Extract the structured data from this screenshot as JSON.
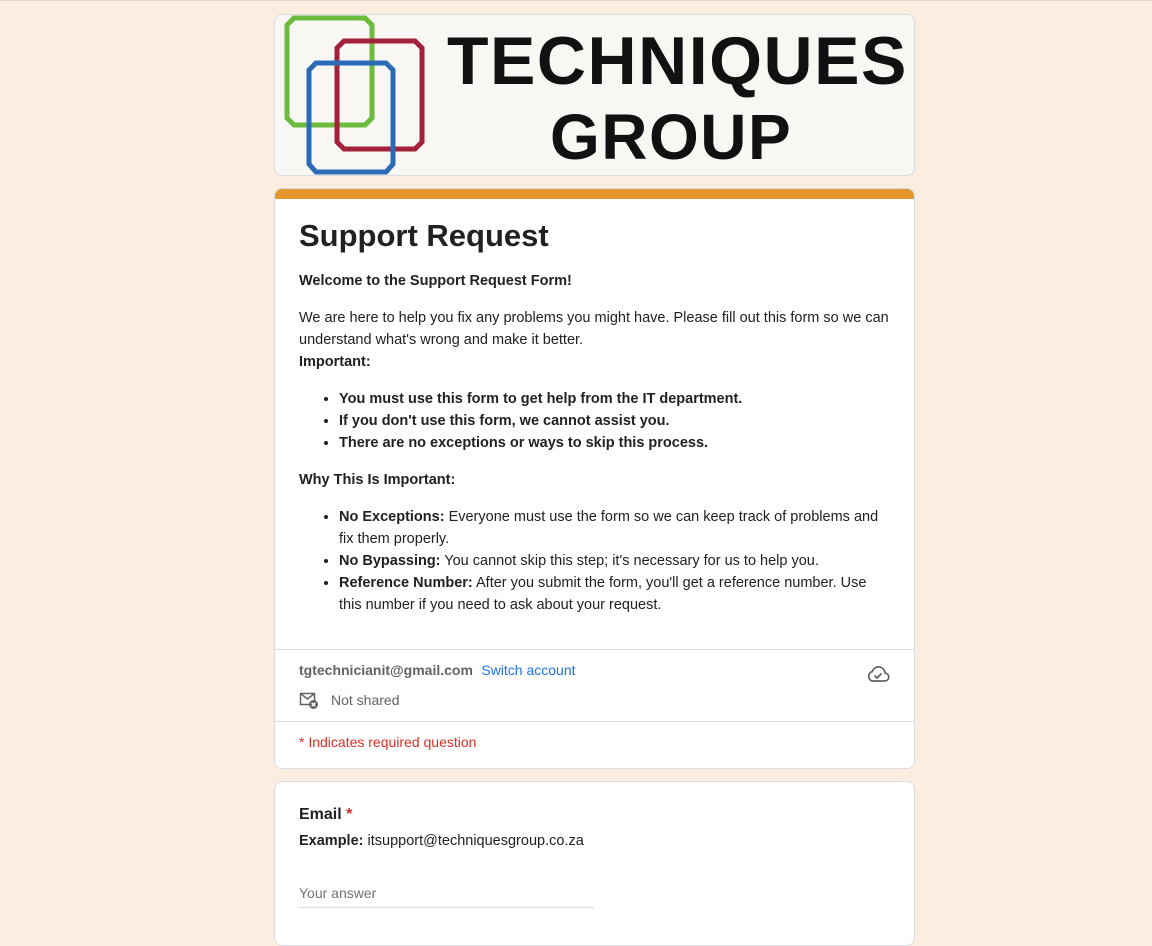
{
  "banner": {
    "brand_line_1": "TECHNIQUES",
    "brand_line_2": "GROUP",
    "logo_colors": {
      "green": "#6cbb3c",
      "red": "#a3213a",
      "blue": "#2b6cb8"
    }
  },
  "form": {
    "accent_color": "#e3972d",
    "title": "Support Request",
    "welcome": "Welcome to the Support Request Form!",
    "intro": "We are here to help you fix any problems you might have. Please fill out this form so we can understand what's wrong and make it better.",
    "important_heading": "Important:",
    "important_items": [
      "You must use this form to get help from the IT department.",
      "If you don't use this form, we cannot assist you.",
      "There are no exceptions or ways to skip this process."
    ],
    "why_heading": "Why This Is Important:",
    "why_items": [
      {
        "label": "No Exceptions:",
        "text": " Everyone must use the form so we can keep track of problems and fix them properly."
      },
      {
        "label": "No Bypassing:",
        "text": " You cannot skip this step; it's necessary for us to help you."
      },
      {
        "label": "Reference Number:",
        "text": " After you submit the form, you'll get a reference number. Use this number if you need to ask about your request."
      }
    ]
  },
  "account": {
    "email": "tgtechnicianit@gmail.com",
    "switch_label": "Switch account",
    "not_shared_label": "Not shared",
    "mail_icon": "mail-not-shared-icon",
    "cloud_icon": "cloud-saved-icon"
  },
  "required_note": "* Indicates required question",
  "question": {
    "title": "Email",
    "required_marker": "*",
    "example_label": "Example:",
    "example_value": " itsupport@techniquesgroup.co.za",
    "value": "",
    "placeholder": "Your answer"
  }
}
